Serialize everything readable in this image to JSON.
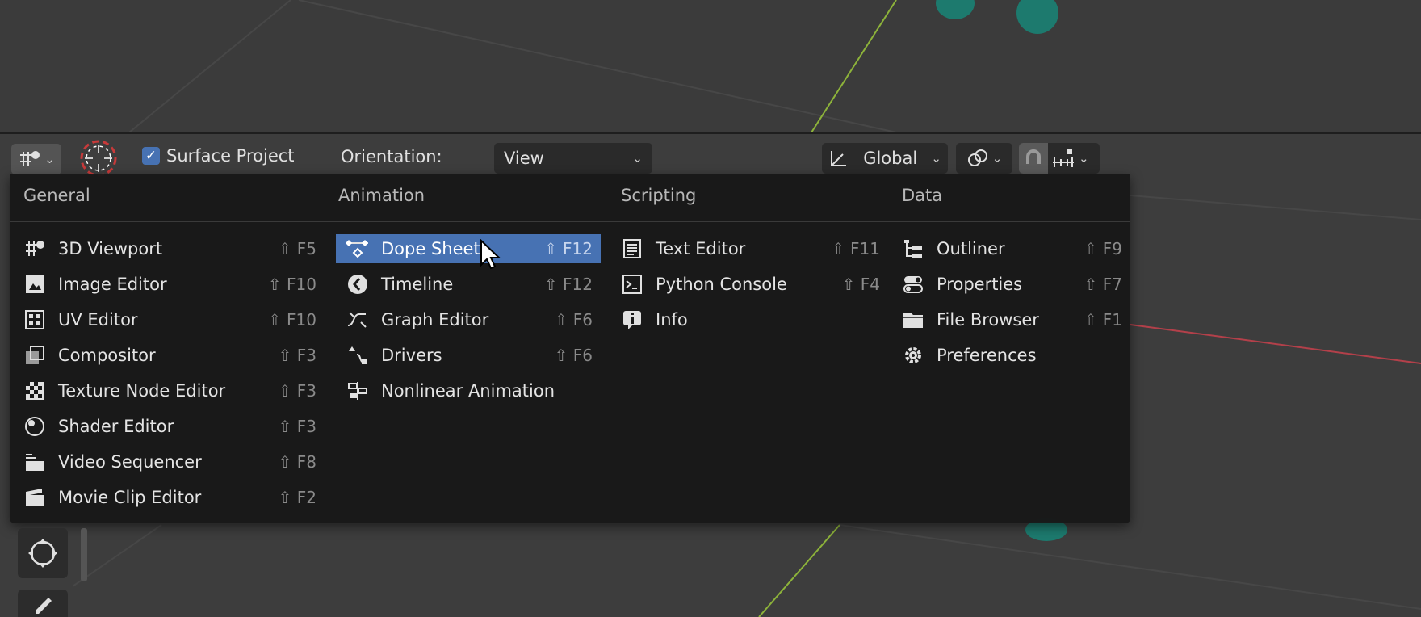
{
  "header": {
    "surface_project": "Surface Project",
    "orientation_label": "Orientation:",
    "orientation_value": "View",
    "transform_orientation": "Global"
  },
  "menu": {
    "general": {
      "heading": "General",
      "items": [
        {
          "label": "3D Viewport",
          "shortcut": "⇧ F5",
          "icon": "viewport-3d-icon"
        },
        {
          "label": "Image Editor",
          "shortcut": "⇧ F10",
          "icon": "image-editor-icon"
        },
        {
          "label": "UV Editor",
          "shortcut": "⇧ F10",
          "icon": "uv-editor-icon"
        },
        {
          "label": "Compositor",
          "shortcut": "⇧ F3",
          "icon": "compositor-icon"
        },
        {
          "label": "Texture Node Editor",
          "shortcut": "⇧ F3",
          "icon": "texture-node-icon"
        },
        {
          "label": "Shader Editor",
          "shortcut": "⇧ F3",
          "icon": "shader-editor-icon"
        },
        {
          "label": "Video Sequencer",
          "shortcut": "⇧ F8",
          "icon": "video-sequencer-icon"
        },
        {
          "label": "Movie Clip Editor",
          "shortcut": "⇧ F2",
          "icon": "movie-clip-icon"
        }
      ]
    },
    "animation": {
      "heading": "Animation",
      "items": [
        {
          "label": "Dope Sheet",
          "shortcut": "⇧ F12",
          "icon": "dope-sheet-icon"
        },
        {
          "label": "Timeline",
          "shortcut": "⇧ F12",
          "icon": "timeline-icon"
        },
        {
          "label": "Graph Editor",
          "shortcut": "⇧ F6",
          "icon": "graph-editor-icon"
        },
        {
          "label": "Drivers",
          "shortcut": "⇧ F6",
          "icon": "drivers-icon"
        },
        {
          "label": "Nonlinear Animation",
          "shortcut": "",
          "icon": "nla-icon"
        }
      ]
    },
    "scripting": {
      "heading": "Scripting",
      "items": [
        {
          "label": "Text Editor",
          "shortcut": "⇧ F11",
          "icon": "text-editor-icon"
        },
        {
          "label": "Python Console",
          "shortcut": "⇧ F4",
          "icon": "python-console-icon"
        },
        {
          "label": "Info",
          "shortcut": "",
          "icon": "info-icon"
        }
      ]
    },
    "data": {
      "heading": "Data",
      "items": [
        {
          "label": "Outliner",
          "shortcut": "⇧ F9",
          "icon": "outliner-icon"
        },
        {
          "label": "Properties",
          "shortcut": "⇧ F7",
          "icon": "properties-icon"
        },
        {
          "label": "File Browser",
          "shortcut": "⇧ F1",
          "icon": "file-browser-icon"
        },
        {
          "label": "Preferences",
          "shortcut": "",
          "icon": "preferences-icon"
        }
      ]
    }
  },
  "active_item": "Dope Sheet",
  "colors": {
    "highlight": "#4772b3",
    "menu_bg": "#181818",
    "viewport_bg": "#3d3d3d",
    "y_axis": "#8db33a",
    "x_axis": "#b3404a"
  }
}
